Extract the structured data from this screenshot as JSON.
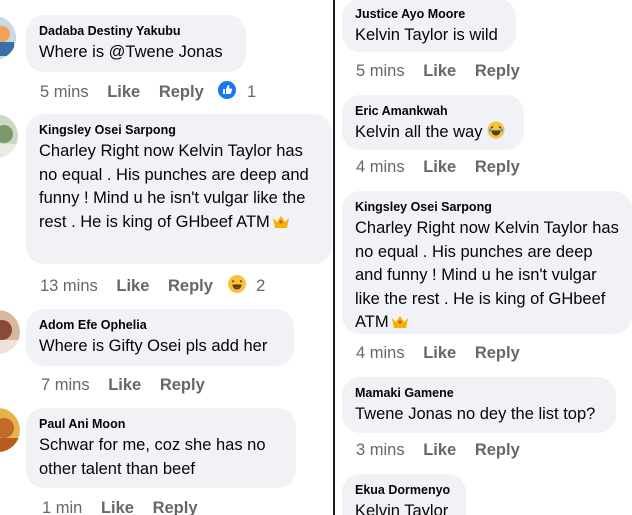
{
  "left": [
    {
      "author": "Dadaba Destiny Yakubu",
      "text": "Where is @Twene Jonas",
      "time": "5 mins",
      "like": "Like",
      "reply": "Reply",
      "reaction_count": "1",
      "reaction": "like-reaction-icon"
    },
    {
      "author": "Kingsley Osei Sarpong",
      "text": "Charley Right now Kelvin Taylor has no equal . His punches are deep and funny ! Mind u he isn't vulgar like the rest .  He is king of GHbeef ATM",
      "time": "13 mins",
      "like": "Like",
      "reply": "Reply",
      "reaction_count": "2",
      "reaction": "haha-reaction-icon"
    },
    {
      "author": "Adom Efe Ophelia",
      "text": "Where is Gifty Osei pls add her",
      "time": "7 mins",
      "like": "Like",
      "reply": "Reply"
    },
    {
      "author": "Paul Ani Moon",
      "text": "Schwar for me, coz she has no other talent than beef",
      "time": "1 min",
      "like": "Like",
      "reply": "Reply"
    }
  ],
  "right": [
    {
      "author": "Justice Ayo Moore",
      "text": "Kelvin Taylor is wild",
      "time": "5 mins",
      "like": "Like",
      "reply": "Reply"
    },
    {
      "author": "Eric Amankwah",
      "text": "Kelvin all the way",
      "time": "4 mins",
      "like": "Like",
      "reply": "Reply"
    },
    {
      "author": "Kingsley Osei Sarpong",
      "text": "Charley Right now Kelvin Taylor has no equal . His punches are deep and funny ! Mind u he isn't vulgar like the rest .  He is king of GHbeef ATM",
      "time": "4 mins",
      "like": "Like",
      "reply": "Reply"
    },
    {
      "author": "Mamaki Gamene",
      "text": "Twene Jonas no dey the list top?",
      "time": "3 mins",
      "like": "Like",
      "reply": "Reply"
    },
    {
      "author": "Ekua Dormenyo",
      "text": "Kelvin Taylor"
    }
  ],
  "colors": {
    "bubble": "#f0f2f5",
    "meta": "#65676b",
    "like_blue": "#1877f2",
    "divider": "#1c1c1c"
  }
}
